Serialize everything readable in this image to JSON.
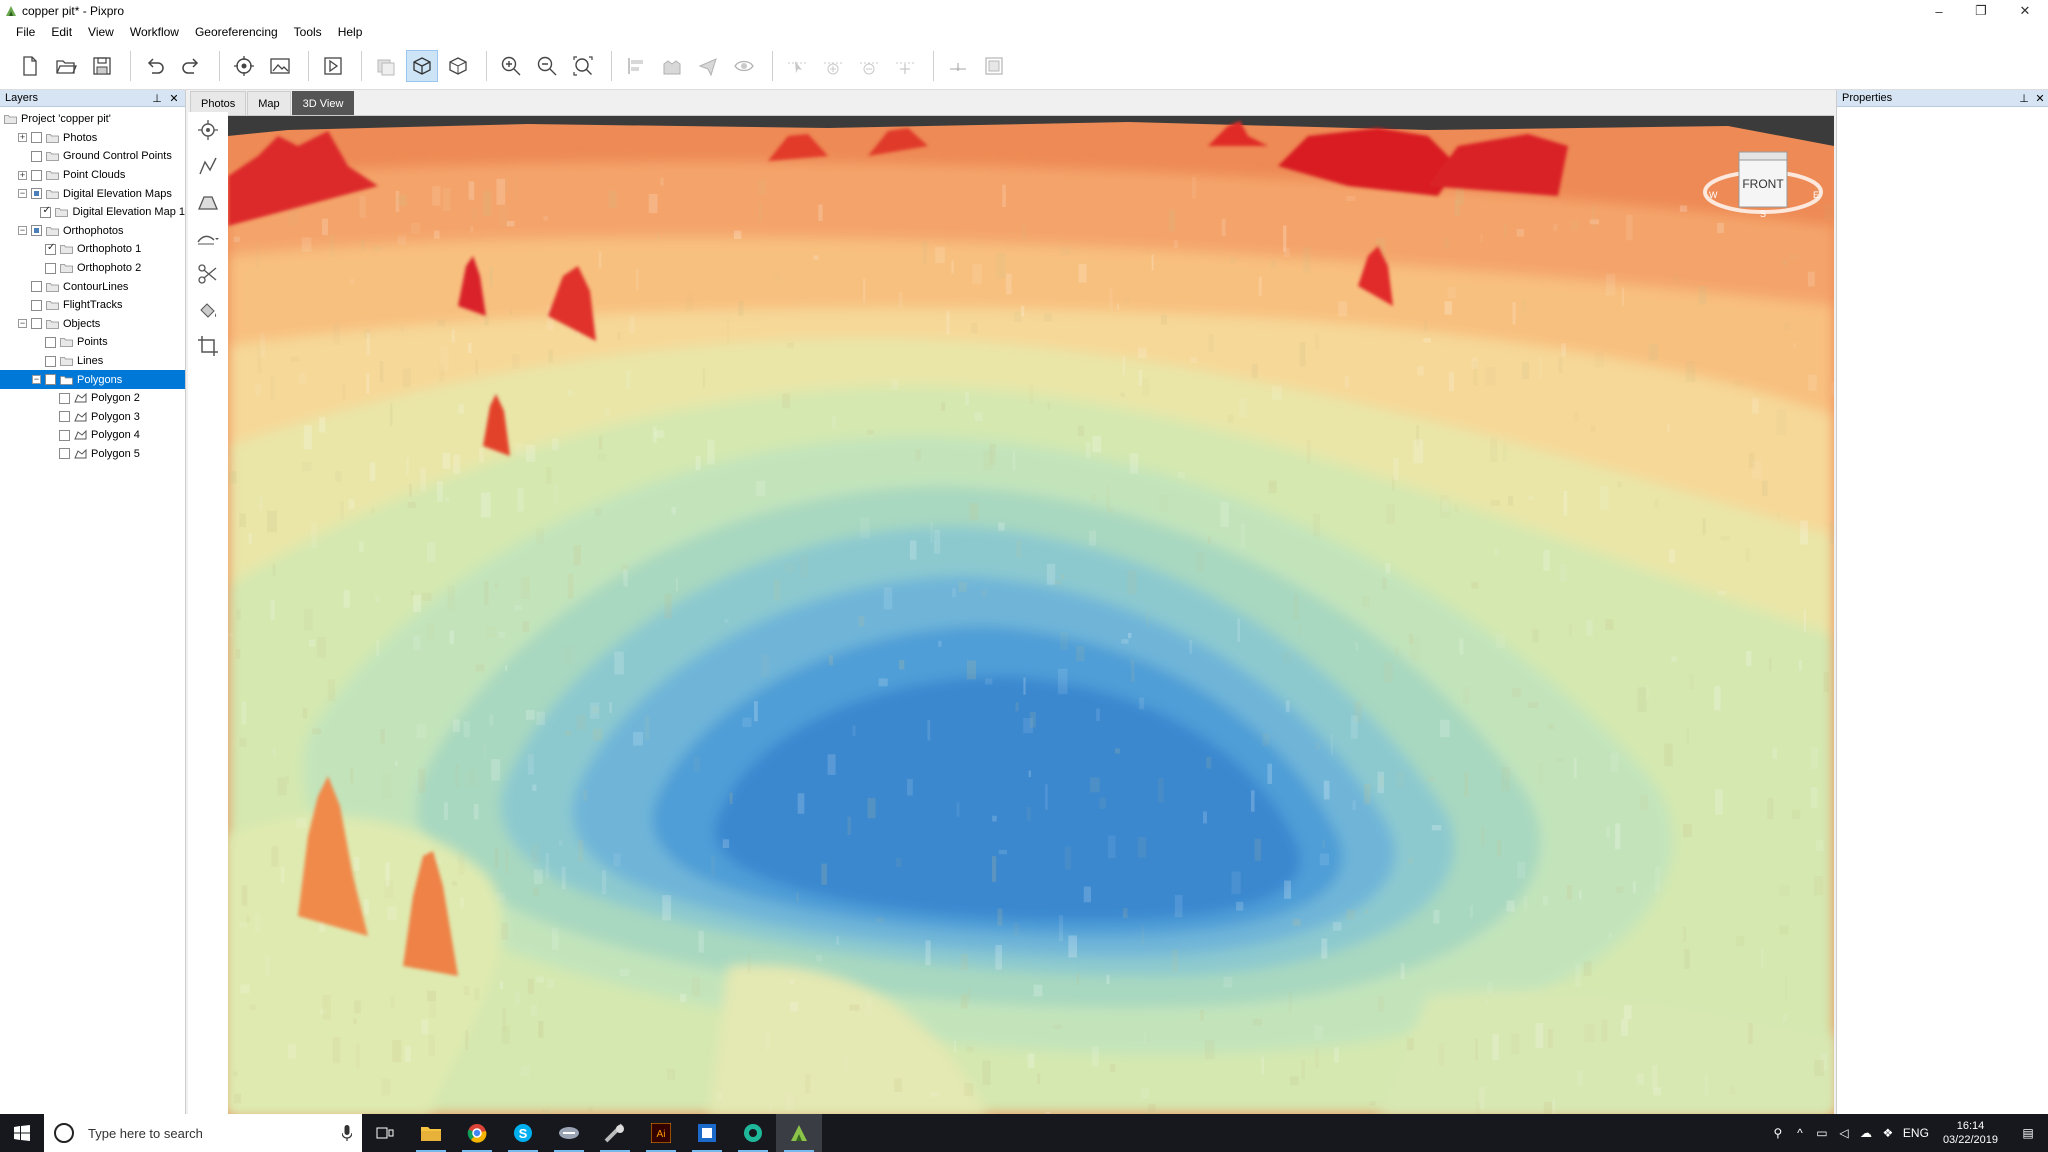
{
  "window": {
    "title": "copper pit* - Pixpro",
    "controls": [
      "–",
      "❐",
      "✕"
    ]
  },
  "menu": [
    "File",
    "Edit",
    "View",
    "Workflow",
    "Georeferencing",
    "Tools",
    "Help"
  ],
  "toolbar": {
    "icons": [
      "new-file-icon",
      "open-folder-icon",
      "save-icon",
      "undo-icon",
      "redo-icon",
      "add-gcp-icon",
      "add-image-icon",
      "run-icon",
      "dem-icon",
      "3d-box-icon",
      "cube-icon",
      "zoom-in-icon",
      "zoom-out-icon",
      "zoom-extent-icon",
      "align-icon",
      "building-icon",
      "flight-icon",
      "eye-icon",
      "select-point-icon",
      "add-point-icon",
      "remove-point-icon",
      "move-point-icon",
      "measure-icon",
      "window-icon"
    ]
  },
  "layers": {
    "title": "Layers",
    "tree": [
      {
        "label": "Project 'copper pit'",
        "level": 0,
        "expander": "",
        "check": "none"
      },
      {
        "label": "Photos",
        "level": 1,
        "expander": "+",
        "check": "empty"
      },
      {
        "label": "Ground Control Points",
        "level": 1,
        "expander": "",
        "check": "empty"
      },
      {
        "label": "Point Clouds",
        "level": 1,
        "expander": "+",
        "check": "empty"
      },
      {
        "label": "Digital Elevation Maps",
        "level": 1,
        "expander": "−",
        "check": "partial"
      },
      {
        "label": "Digital Elevation Map 1",
        "level": 2,
        "expander": "",
        "check": "checked"
      },
      {
        "label": "Orthophotos",
        "level": 1,
        "expander": "−",
        "check": "partial"
      },
      {
        "label": "Orthophoto 1",
        "level": 2,
        "expander": "",
        "check": "checked"
      },
      {
        "label": "Orthophoto 2",
        "level": 2,
        "expander": "",
        "check": "empty"
      },
      {
        "label": "ContourLines",
        "level": 1,
        "expander": "",
        "check": "empty"
      },
      {
        "label": "FlightTracks",
        "level": 1,
        "expander": "",
        "check": "empty"
      },
      {
        "label": "Objects",
        "level": 1,
        "expander": "−",
        "check": "empty"
      },
      {
        "label": "Points",
        "level": 2,
        "expander": "",
        "check": "empty"
      },
      {
        "label": "Lines",
        "level": 2,
        "expander": "",
        "check": "empty"
      },
      {
        "label": "Polygons",
        "level": 2,
        "expander": "−",
        "check": "empty",
        "selected": true
      },
      {
        "label": "Polygon 2",
        "level": 3,
        "expander": "",
        "check": "empty",
        "polygon": true
      },
      {
        "label": "Polygon 3",
        "level": 3,
        "expander": "",
        "check": "empty",
        "polygon": true
      },
      {
        "label": "Polygon 4",
        "level": 3,
        "expander": "",
        "check": "empty",
        "polygon": true
      },
      {
        "label": "Polygon 5",
        "level": 3,
        "expander": "",
        "check": "empty",
        "polygon": true
      }
    ]
  },
  "tabs": [
    {
      "label": "Photos",
      "active": false
    },
    {
      "label": "Map",
      "active": false
    },
    {
      "label": "3D View",
      "active": true
    }
  ],
  "viewcube": {
    "face": "FRONT",
    "compass": [
      "W",
      "E",
      "S"
    ]
  },
  "properties": {
    "title": "Properties"
  },
  "taskbar": {
    "search_placeholder": "Type here to search",
    "apps": [
      "task-view-icon",
      "file-explorer-icon",
      "chrome-icon",
      "skype-icon",
      "app-icon-1",
      "app-icon-2",
      "illustrator-icon",
      "app-icon-3",
      "app-icon-4",
      "pixpro-icon"
    ],
    "language": "ENG",
    "time": "16:14",
    "date": "03/22/2019"
  },
  "colors": {
    "selection": "#0078d7",
    "panel_header": "#d6e4f3",
    "taskbar": "#16181d"
  }
}
